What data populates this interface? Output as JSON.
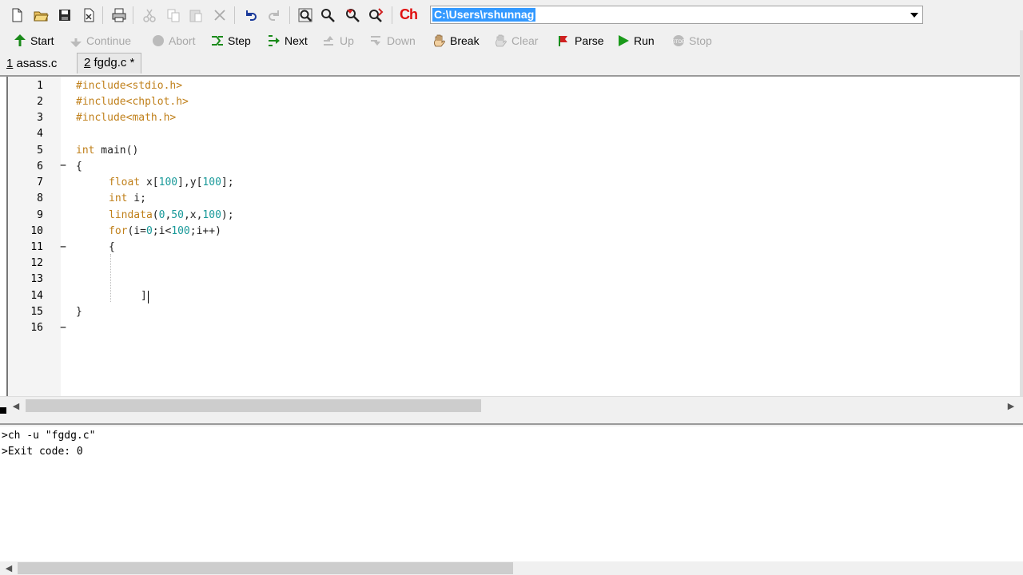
{
  "toolbar": {
    "icons": [
      "new-file-icon",
      "open-folder-icon",
      "save-icon",
      "close-file-icon",
      "print-icon",
      "cut-icon",
      "copy-icon",
      "paste-icon",
      "delete-icon",
      "undo-icon",
      "redo-icon",
      "find-icon",
      "zoom-icon",
      "find-next-icon",
      "replace-icon"
    ],
    "logo_text": "Ch",
    "path": "C:\\Users\\rshunnag"
  },
  "debug": {
    "start": "Start",
    "continue": "Continue",
    "abort": "Abort",
    "step": "Step",
    "next": "Next",
    "up": "Up",
    "down": "Down",
    "break": "Break",
    "clear": "Clear",
    "parse": "Parse",
    "run": "Run",
    "stop": "Stop"
  },
  "tabs": [
    {
      "num": "1",
      "label": " asass.c"
    },
    {
      "num": "2",
      "label": " fgdg.c *"
    }
  ],
  "editor": {
    "line_numbers": [
      "1",
      "2",
      "3",
      "4",
      "5",
      "6",
      "7",
      "8",
      "9",
      "10",
      "11",
      "12",
      "13",
      "14",
      "15",
      "16"
    ],
    "lines": {
      "l1": "#include<stdio.h>",
      "l2": "#include<chplot.h>",
      "l3": "#include<math.h>",
      "l5_kw": "int",
      "l5_rest": " main()",
      "l6": "{",
      "l7_kw": "float",
      "l7_a": " x[",
      "l7_n1": "100",
      "l7_b": "],y[",
      "l7_n2": "100",
      "l7_c": "];",
      "l8_kw": "int",
      "l8_rest": " i;",
      "l9_fn": "lindata",
      "l9_a": "(",
      "l9_n1": "0",
      "l9_b": ",",
      "l9_n2": "50",
      "l9_c": ",x,",
      "l9_n3": "100",
      "l9_d": ");",
      "l10_kw": "for",
      "l10_a": "(i=",
      "l10_n1": "0",
      "l10_b": ";i<",
      "l10_n2": "100",
      "l10_c": ";i++)",
      "l11": "{",
      "l14": "]",
      "l15": "}"
    }
  },
  "output": {
    "line1": ">ch -u \"fgdg.c\"",
    "line2": ">Exit code: 0"
  }
}
